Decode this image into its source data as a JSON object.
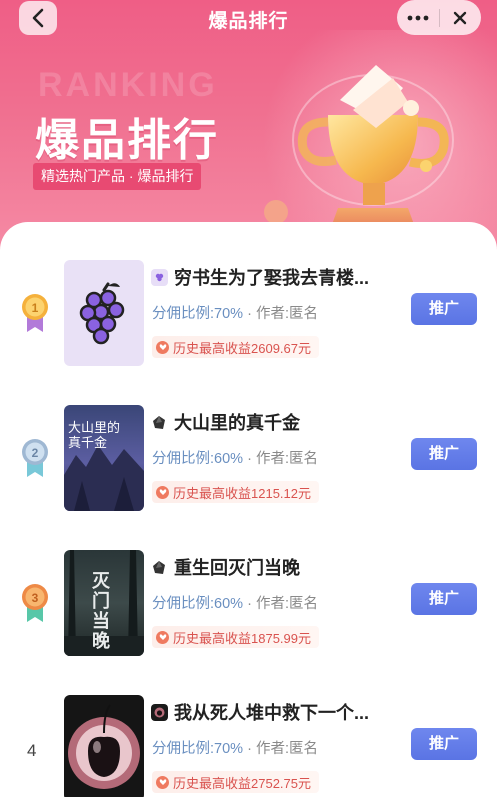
{
  "nav": {
    "title": "爆品排行",
    "back_icon": "chevron-left-icon",
    "more_icon": "more-dots-icon",
    "close_icon": "close-icon"
  },
  "hero": {
    "watermark": "RANKING",
    "title": "爆品排行",
    "subtitle": "精选热门产品 · 爆品排行"
  },
  "colors": {
    "hero": "#ef5e86",
    "button": "#5a74e4",
    "earn_text": "#d9534f"
  },
  "items": [
    {
      "rank": "1",
      "title": "穷书生为了娶我去青楼...",
      "commission_label": "分佣比例:70%",
      "sep": " · ",
      "author": "作者:匿名",
      "earn": "历史最高收益2609.67元",
      "button": "推广",
      "cover": "grape-icon"
    },
    {
      "rank": "2",
      "title": "大山里的真千金",
      "commission_label": "分佣比例:60%",
      "sep": " · ",
      "author": "作者:匿名",
      "earn": "历史最高收益1215.12元",
      "button": "推广",
      "cover_text": "大山里的真千金"
    },
    {
      "rank": "3",
      "title": "重生回灭门当晚",
      "commission_label": "分佣比例:60%",
      "sep": " · ",
      "author": "作者:匿名",
      "earn": "历史最高收益1875.99元",
      "button": "推广",
      "cover_text": "灭门当晚"
    },
    {
      "rank": "4",
      "title": "我从死人堆中救下一个...",
      "commission_label": "分佣比例:70%",
      "sep": " · ",
      "author": "作者:匿名",
      "earn": "历史最高收益2752.75元",
      "button": "推广",
      "cover": "cherry-icon"
    }
  ]
}
